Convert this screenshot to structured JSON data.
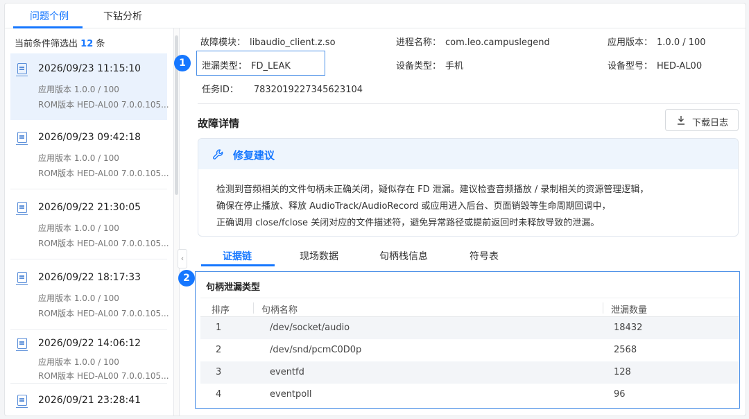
{
  "tabs": [
    {
      "label": "问题个例",
      "active": true
    },
    {
      "label": "下钻分析",
      "active": false
    }
  ],
  "filter": {
    "prefix": "当前条件筛选出",
    "count": "12",
    "suffix": "条"
  },
  "records": [
    {
      "time": "2026/09/23 11:15:10",
      "app_version": "应用版本  1.0.0 / 100",
      "rom": "ROM版本  HED-AL00 7.0.0.105...",
      "selected": true
    },
    {
      "time": "2026/09/23 09:42:18",
      "app_version": "应用版本  1.0.0 / 100",
      "rom": "ROM版本  HED-AL00 7.0.0.105...",
      "selected": false
    },
    {
      "time": "2026/09/22 21:30:05",
      "app_version": "应用版本  1.0.0 / 100",
      "rom": "ROM版本  HED-AL00 7.0.0.105...",
      "selected": false
    },
    {
      "time": "2026/09/22 18:17:33",
      "app_version": "应用版本  1.0.0 / 100",
      "rom": "ROM版本  HED-AL00 7.0.0.105...",
      "selected": false
    },
    {
      "time": "2026/09/22 14:06:12",
      "app_version": "应用版本  1.0.0 / 100",
      "rom": "ROM版本  HED-AL00 7.0.0.105...",
      "selected": false
    },
    {
      "time": "2026/09/21 23:28:41",
      "app_version": "",
      "rom": "",
      "selected": false
    }
  ],
  "collapse_glyph": "‹",
  "info": {
    "fault_module": {
      "label": "故障模块：",
      "value": "libaudio_client.z.so"
    },
    "process_name": {
      "label": "进程名称：",
      "value": "com.leo.campuslegend"
    },
    "app_version": {
      "label": "应用版本：",
      "value": "1.0.0 / 100"
    },
    "leak_type": {
      "label": "泄漏类型：",
      "value": "FD_LEAK"
    },
    "device_type": {
      "label": "设备类型：",
      "value": "手机"
    },
    "device_model": {
      "label": "设备型号：",
      "value": "HED-AL00"
    },
    "task_id": {
      "label": "任务ID：",
      "value": "7832019227345623104"
    }
  },
  "badges": [
    "1",
    "2"
  ],
  "details": {
    "title": "故障详情",
    "download_label": "下载日志",
    "download_icon": "download-icon"
  },
  "advice": {
    "title": "修复建议",
    "icon": "wrench-icon",
    "lines": [
      "检测到音频相关的文件句柄未正确关闭，疑似存在 FD 泄漏。建议检查音频播放 / 录制相关的资源管理逻辑，",
      "确保在停止播放、释放 AudioTrack/AudioRecord 或应用进入后台、页面销毁等生命周期回调中，",
      "正确调用 close/fclose 关闭对应的文件描述符，避免异常路径或提前返回时未释放导致的泄漏。"
    ]
  },
  "sub_tabs": [
    {
      "label": "证据链",
      "active": true
    },
    {
      "label": "现场数据",
      "active": false
    },
    {
      "label": "句柄栈信息",
      "active": false
    },
    {
      "label": "符号表",
      "active": false
    }
  ],
  "evidence": {
    "title": "句柄泄漏类型",
    "columns": [
      "排序",
      "句柄名称",
      "泄漏数量"
    ],
    "rows": [
      {
        "rank": "1",
        "name": "/dev/socket/audio",
        "count": "18432"
      },
      {
        "rank": "2",
        "name": "/dev/snd/pcmC0D0p",
        "count": "2568"
      },
      {
        "rank": "3",
        "name": "eventfd",
        "count": "128"
      },
      {
        "rank": "4",
        "name": "eventpoll",
        "count": "96"
      }
    ]
  },
  "colors": {
    "accent": "#1677ff",
    "highlight_border": "#4a8fe7",
    "selected_bg": "#eaf2fd"
  }
}
